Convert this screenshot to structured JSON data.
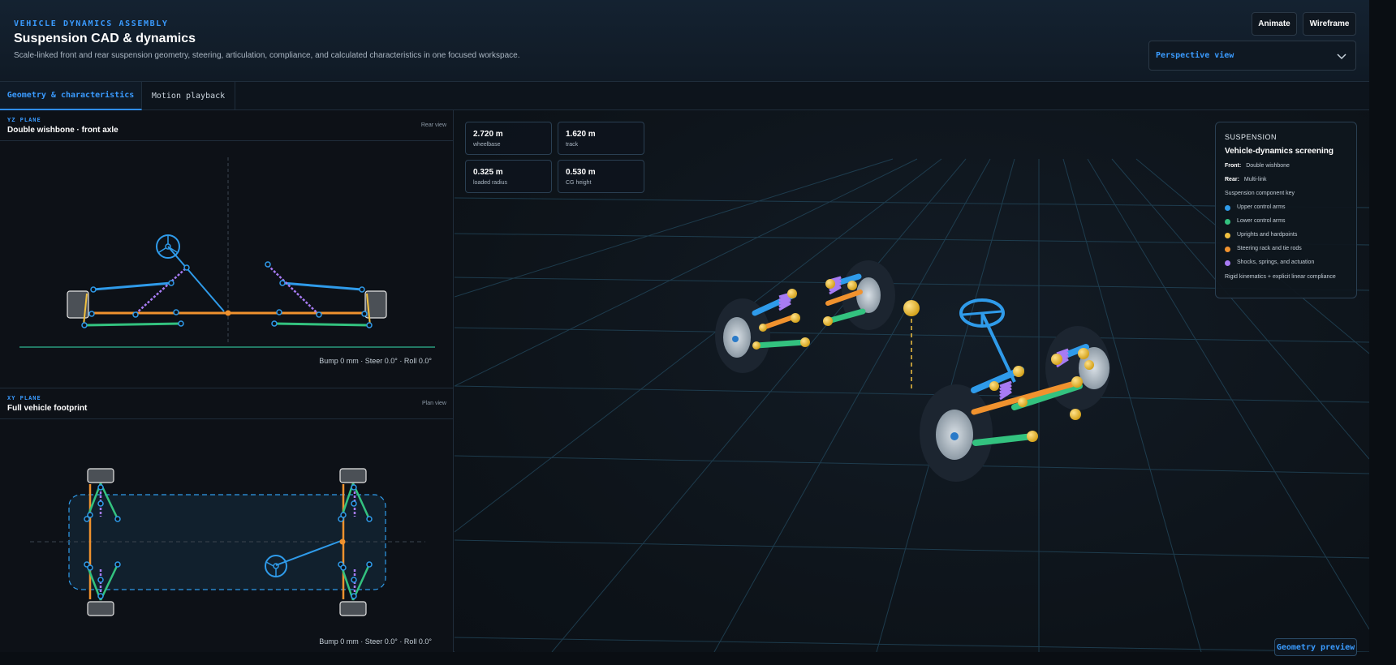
{
  "header": {
    "eyebrow": "VEHICLE DYNAMICS ASSEMBLY",
    "title": "Suspension CAD & dynamics",
    "subtitle": "Scale-linked front and rear suspension geometry, steering, articulation, compliance, and calculated characteristics in one focused workspace.",
    "animate_label": "Animate",
    "wireframe_label": "Wireframe",
    "view_select": "Perspective view"
  },
  "tabs": [
    {
      "label": "Geometry & characteristics",
      "active": true
    },
    {
      "label": "Motion playback",
      "active": false
    }
  ],
  "yz_pane": {
    "plane": "YZ PLANE",
    "title": "Double wishbone · front axle",
    "view": "Rear view",
    "status": "Bump 0 mm · Steer 0.0° · Roll 0.0°"
  },
  "xy_pane": {
    "plane": "XY PLANE",
    "title": "Full vehicle footprint",
    "view": "Plan view",
    "status": "Bump 0 mm · Steer 0.0° · Roll 0.0°"
  },
  "stats": [
    {
      "value": "2.720 m",
      "label": "wheelbase"
    },
    {
      "value": "1.620 m",
      "label": "track"
    },
    {
      "value": "0.325 m",
      "label": "loaded radius"
    },
    {
      "value": "0.530 m",
      "label": "CG height"
    }
  ],
  "legend": {
    "eyebrow": "SUSPENSION",
    "title": "Vehicle-dynamics screening",
    "front_label": "Front:",
    "front_value": "Double wishbone",
    "rear_label": "Rear:",
    "rear_value": "Multi-link",
    "key_title": "Suspension component key",
    "items": [
      {
        "label": "Upper control arms",
        "color": "#2f9bea"
      },
      {
        "label": "Lower control arms",
        "color": "#33c27f"
      },
      {
        "label": "Uprights and hardpoints",
        "color": "#f0c040"
      },
      {
        "label": "Steering rack and tie rods",
        "color": "#f0922e"
      },
      {
        "label": "Shocks, springs, and actuation",
        "color": "#a77bf3"
      }
    ],
    "note": "Rigid kinematics + explicit linear compliance"
  },
  "geometry_preview_label": "Geometry preview",
  "colors": {
    "accent": "#3a9bff",
    "upper_arm": "#2f9bea",
    "lower_arm": "#33c27f",
    "upright": "#f0c040",
    "steering": "#f0922e",
    "shock": "#a77bf3"
  }
}
